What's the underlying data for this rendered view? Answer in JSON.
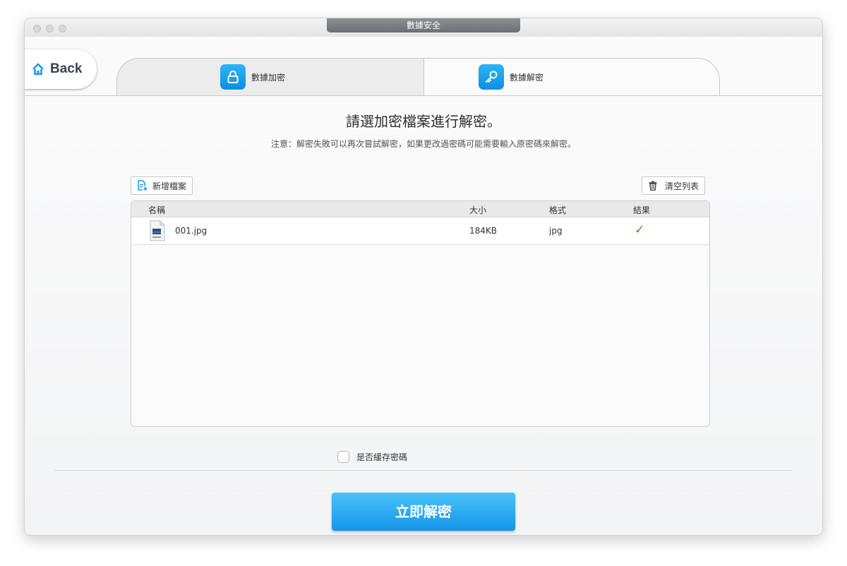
{
  "window": {
    "title": "數據安全"
  },
  "nav": {
    "back_label": "Back"
  },
  "tabs": [
    {
      "label": "數據加密",
      "icon": "lock-icon"
    },
    {
      "label": "數據解密",
      "icon": "key-icon"
    }
  ],
  "main": {
    "heading": "請選加密檔案進行解密。",
    "note": "注意：解密失敗可以再次嘗試解密，如果更改過密碼可能需要輸入原密碼來解密。"
  },
  "toolbar": {
    "add_label": "新增檔案",
    "clear_label": "清空列表"
  },
  "table": {
    "columns": [
      "名稱",
      "大小",
      "格式",
      "結果"
    ],
    "rows": [
      {
        "name": "001.jpg",
        "size": "184KB",
        "format": "jpg",
        "result": "✓"
      }
    ]
  },
  "options": {
    "save_password_label": "是否緩存密碼",
    "save_password_checked": false
  },
  "action": {
    "decrypt_label": "立即解密"
  },
  "colors": {
    "accent": "#1b9cec",
    "success": "#3a9d2e"
  }
}
